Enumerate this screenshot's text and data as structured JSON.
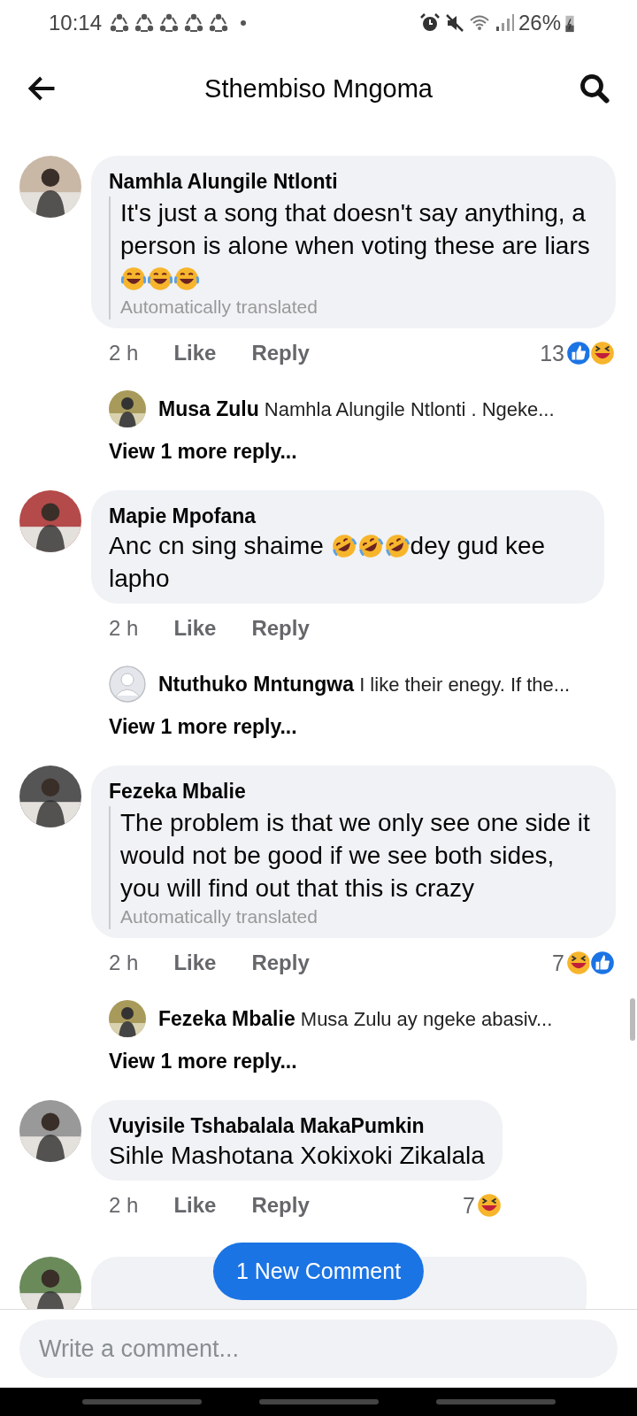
{
  "status_bar": {
    "time": "10:14",
    "battery": "26%"
  },
  "header": {
    "title": "Sthembiso Mngoma"
  },
  "comments": [
    {
      "author": "Namhla Alungile Ntlonti",
      "translated": true,
      "note": "Automatically translated",
      "body": [
        {
          "kind": "text",
          "text": "It's just a song that doesn't say anything, a person is alone when voting these are liars"
        },
        {
          "kind": "joy"
        },
        {
          "kind": "joy"
        },
        {
          "kind": "joy"
        }
      ],
      "time": "2 h",
      "like": "Like",
      "reply": "Reply",
      "reaction_count": "13",
      "reactions": [
        {
          "kind": "like"
        },
        {
          "kind": "haha"
        }
      ],
      "reply_preview": {
        "author": "Musa Zulu",
        "default_avatar": false,
        "text": "Namhla Alungile Ntlonti . Ngeke..."
      },
      "more": "View 1 more reply..."
    },
    {
      "author": "Mapie Mpofana",
      "translated": false,
      "body": [
        {
          "kind": "text",
          "text": "Anc cn sing shaime "
        },
        {
          "kind": "rofl"
        },
        {
          "kind": "rofl"
        },
        {
          "kind": "rofl"
        },
        {
          "kind": "text",
          "text": "dey gud kee lapho"
        }
      ],
      "time": "2 h",
      "like": "Like",
      "reply": "Reply",
      "reply_preview": {
        "author": "Ntuthuko Mntungwa",
        "default_avatar": true,
        "text": "I like their enegy. If the..."
      },
      "more": "View 1 more reply..."
    },
    {
      "author": "Fezeka Mbalie",
      "translated": true,
      "note": "Automatically translated",
      "body": [
        {
          "kind": "text",
          "text": "The problem is that we only see one side it would not be good if we see both sides, you will find out that this is crazy"
        }
      ],
      "time": "2 h",
      "like": "Like",
      "reply": "Reply",
      "reaction_count": "7",
      "reactions": [
        {
          "kind": "haha"
        },
        {
          "kind": "like"
        }
      ],
      "reply_preview": {
        "author": "Fezeka Mbalie",
        "default_avatar": false,
        "text": "Musa Zulu  ay ngeke abasiv..."
      },
      "more": "View 1 more reply..."
    },
    {
      "author": "Vuyisile Tshabalala MakaPumkin",
      "translated": false,
      "body": [
        {
          "kind": "text",
          "text": "Sihle Mashotana Xokixoki Zikalala"
        }
      ],
      "time": "2 h",
      "like": "Like",
      "reply": "Reply",
      "reaction_count": "7",
      "reactions": [
        {
          "kind": "haha"
        }
      ]
    }
  ],
  "new_comment_button": "1 New Comment",
  "composer": {
    "placeholder": "Write a comment..."
  }
}
